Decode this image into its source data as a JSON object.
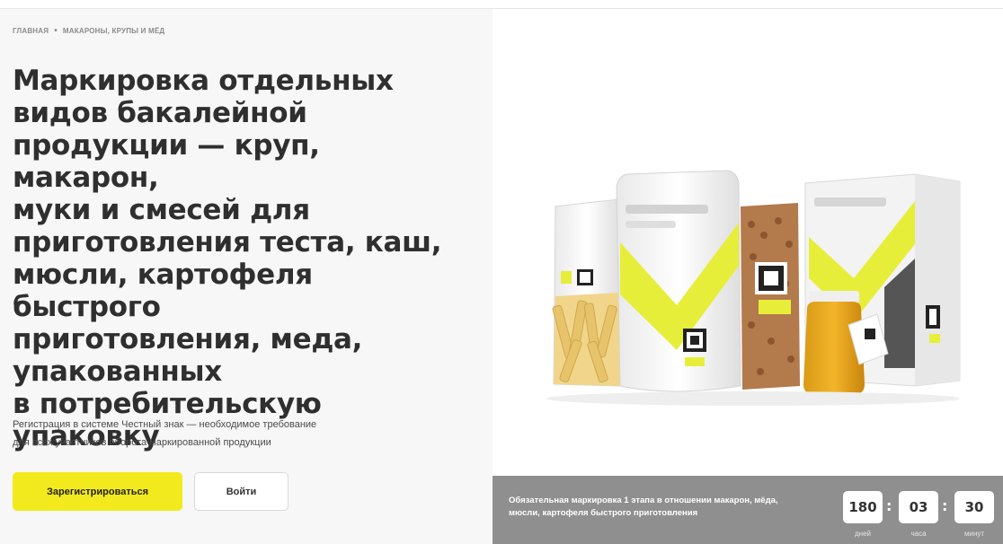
{
  "breadcrumb": {
    "home": "ГЛАВНАЯ",
    "separator": "•",
    "current": "МАКАРОНЫ, КРУПЫ И МЁД"
  },
  "hero": {
    "title_lines": [
      "Маркировка отдельных",
      "видов бакалейной",
      "продукции — круп, макарон,",
      "муки и смесей для",
      "приготовления теста, каш,",
      "мюсли, картофеля быстрого",
      "приготовления, меда,",
      "упакованных",
      "в потребительскую",
      "упаковку"
    ],
    "subtitle_lines": [
      "Регистрация в системе Честный знак — необходимое требование",
      "для всех участников оборота маркированной продукции"
    ],
    "register_label": "Зарегистрироваться",
    "login_label": "Войти"
  },
  "product_image": {
    "alt": "packages of pasta, buckwheat, grain, honey with labeling marks",
    "accent_color": "#e6ee3a"
  },
  "notice": {
    "text_lines": [
      "Обязательная маркировка 1 этапа в отношении макарон, мёда,",
      "мюсли, картофеля быстрого приготовления"
    ],
    "timer": {
      "days": "180",
      "hours": "03",
      "minutes": "30",
      "days_label": "дней",
      "hours_label": "часа",
      "minutes_label": "минут",
      "separator": ":"
    }
  },
  "colors": {
    "primary_yellow": "#f2ea1c",
    "notice_bar": "#8f8f8f",
    "left_panel": "#f7f7f7"
  }
}
